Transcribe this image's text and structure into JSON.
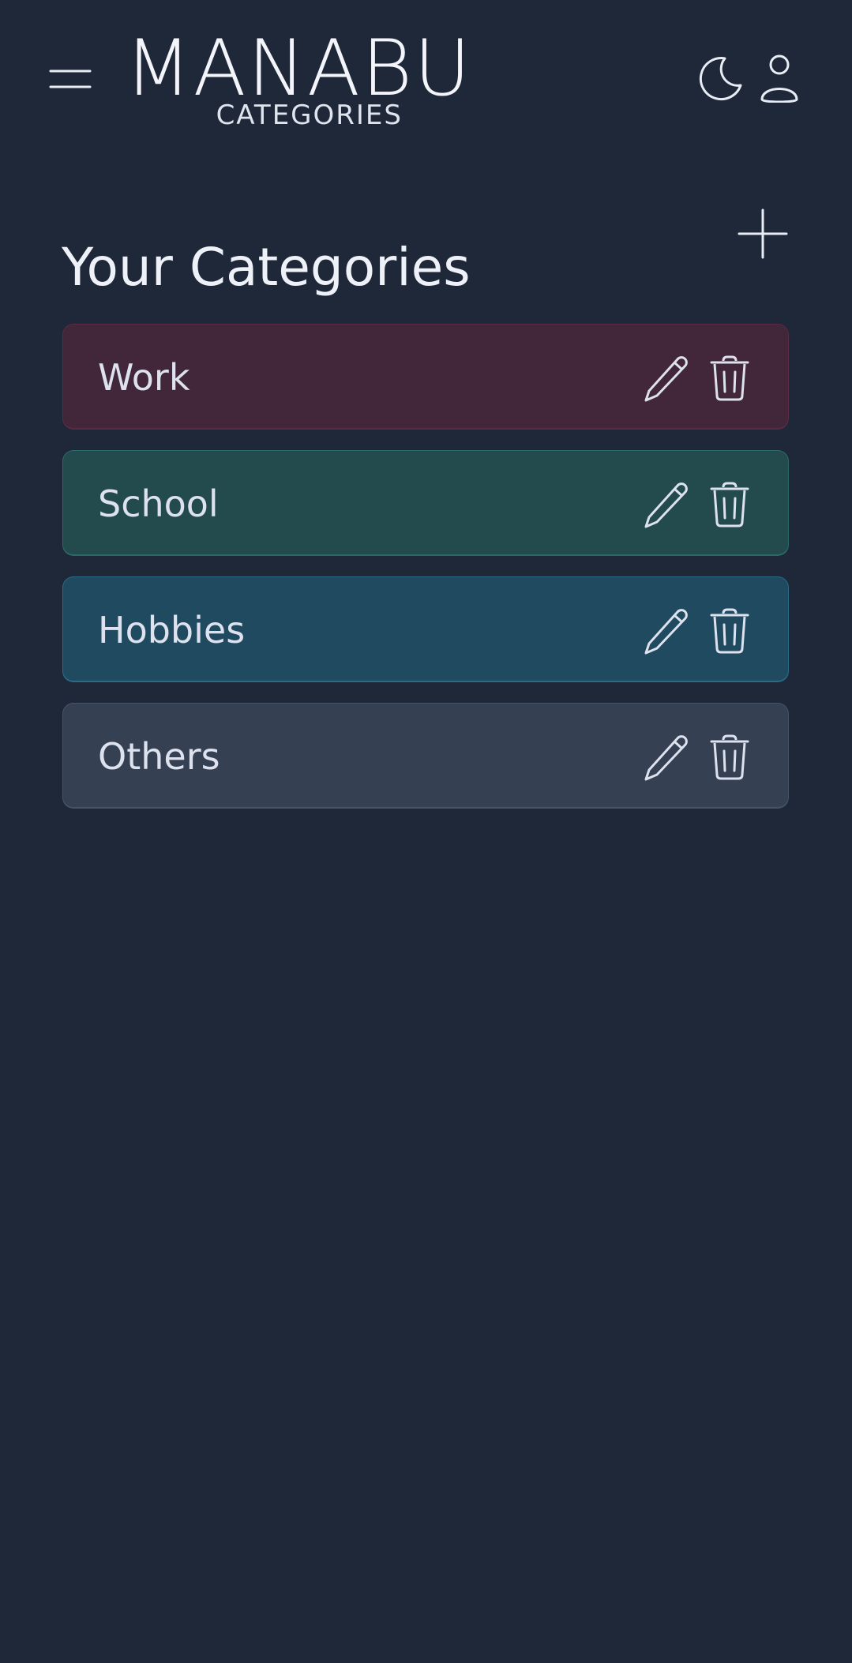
{
  "header": {
    "app_name": "MANABU",
    "section_name": "CATEGORIES",
    "menu_icon": "hamburger-menu-icon",
    "theme_icon": "moon-icon",
    "profile_icon": "user-icon"
  },
  "main": {
    "title": "Your Categories",
    "add_icon": "plus-icon"
  },
  "categories": [
    {
      "label": "Work",
      "color": "#42263a",
      "border": "#5a2c44"
    },
    {
      "label": "School",
      "color": "#234a4d",
      "border": "#2c6a68"
    },
    {
      "label": "Hobbies",
      "color": "#204a5f",
      "border": "#2b6b86"
    },
    {
      "label": "Others",
      "color": "#354052",
      "border": "#465468"
    }
  ],
  "card_actions": {
    "edit_icon": "pencil-icon",
    "delete_icon": "trash-icon"
  },
  "colors": {
    "background": "#1f2839",
    "text": "#e4e8f2"
  }
}
